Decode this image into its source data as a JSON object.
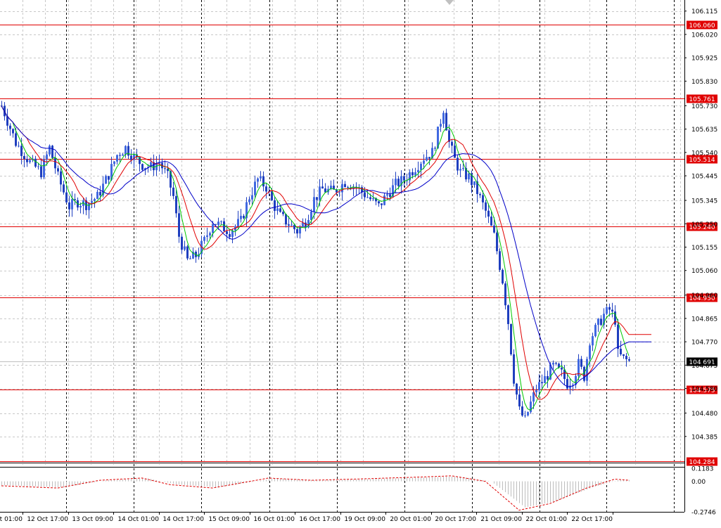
{
  "chart_data": {
    "type": "candlestick",
    "symbol_note": "",
    "ylim": [
      104.27,
      106.16
    ],
    "y_ticks": [
      "106.115",
      "106.020",
      "105.925",
      "105.830",
      "105.730",
      "105.635",
      "105.540",
      "105.445",
      "105.345",
      "105.250",
      "105.155",
      "105.060",
      "104.960",
      "104.865",
      "104.770",
      "104.675",
      "104.580",
      "104.480",
      "104.385"
    ],
    "x_ticks": [
      "12 Oct 01:00",
      "12 Oct 17:00",
      "13 Oct 09:00",
      "14 Oct 01:00",
      "14 Oct 17:00",
      "15 Oct 09:00",
      "16 Oct 01:00",
      "16 Oct 17:00",
      "19 Oct 09:00",
      "20 Oct 01:00",
      "20 Oct 17:00",
      "21 Oct 09:00",
      "22 Oct 01:00",
      "22 Oct 17:00"
    ],
    "levels": [
      {
        "label": "106.060",
        "value": 106.06
      },
      {
        "label": "105.761",
        "value": 105.761
      },
      {
        "label": "105.514",
        "value": 105.514
      },
      {
        "label": "105.240",
        "value": 105.24
      },
      {
        "label": "104.950",
        "value": 104.95
      },
      {
        "label": "104.575",
        "value": 104.575
      },
      {
        "label": "104.284",
        "value": 104.284
      }
    ],
    "current_price": {
      "label": "104.691",
      "value": 104.691
    },
    "price_path": [
      {
        "x": 0,
        "y": 105.73
      },
      {
        "x": 5,
        "y": 105.58
      },
      {
        "x": 10,
        "y": 105.5
      },
      {
        "x": 14,
        "y": 105.46
      },
      {
        "x": 17,
        "y": 105.56
      },
      {
        "x": 20,
        "y": 105.44
      },
      {
        "x": 24,
        "y": 105.32
      },
      {
        "x": 27,
        "y": 105.34
      },
      {
        "x": 30,
        "y": 105.33
      },
      {
        "x": 34,
        "y": 105.36
      },
      {
        "x": 38,
        "y": 105.45
      },
      {
        "x": 41,
        "y": 105.53
      },
      {
        "x": 44,
        "y": 105.56
      },
      {
        "x": 47,
        "y": 105.52
      },
      {
        "x": 50,
        "y": 105.49
      },
      {
        "x": 53,
        "y": 105.48
      },
      {
        "x": 56,
        "y": 105.5
      },
      {
        "x": 59,
        "y": 105.44
      },
      {
        "x": 61,
        "y": 105.36
      },
      {
        "x": 63,
        "y": 105.2
      },
      {
        "x": 66,
        "y": 105.1
      },
      {
        "x": 69,
        "y": 105.12
      },
      {
        "x": 72,
        "y": 105.18
      },
      {
        "x": 75,
        "y": 105.26
      },
      {
        "x": 78,
        "y": 105.24
      },
      {
        "x": 81,
        "y": 105.22
      },
      {
        "x": 85,
        "y": 105.26
      },
      {
        "x": 88,
        "y": 105.36
      },
      {
        "x": 91,
        "y": 105.43
      },
      {
        "x": 94,
        "y": 105.4
      },
      {
        "x": 96,
        "y": 105.34
      },
      {
        "x": 99,
        "y": 105.28
      },
      {
        "x": 102,
        "y": 105.25
      },
      {
        "x": 105,
        "y": 105.22
      },
      {
        "x": 108,
        "y": 105.26
      },
      {
        "x": 111,
        "y": 105.35
      },
      {
        "x": 114,
        "y": 105.39
      },
      {
        "x": 118,
        "y": 105.38
      },
      {
        "x": 122,
        "y": 105.42
      },
      {
        "x": 126,
        "y": 105.4
      },
      {
        "x": 130,
        "y": 105.36
      },
      {
        "x": 134,
        "y": 105.32
      },
      {
        "x": 137,
        "y": 105.37
      },
      {
        "x": 140,
        "y": 105.41
      },
      {
        "x": 143,
        "y": 105.43
      },
      {
        "x": 147,
        "y": 105.48
      },
      {
        "x": 150,
        "y": 105.52
      },
      {
        "x": 153,
        "y": 105.54
      },
      {
        "x": 155,
        "y": 105.62
      },
      {
        "x": 157,
        "y": 105.72
      },
      {
        "x": 159,
        "y": 105.58
      },
      {
        "x": 161,
        "y": 105.51
      },
      {
        "x": 163,
        "y": 105.46
      },
      {
        "x": 166,
        "y": 105.44
      },
      {
        "x": 169,
        "y": 105.38
      },
      {
        "x": 172,
        "y": 105.3
      },
      {
        "x": 175,
        "y": 105.2
      },
      {
        "x": 178,
        "y": 105.02
      },
      {
        "x": 180,
        "y": 104.85
      },
      {
        "x": 182,
        "y": 104.62
      },
      {
        "x": 184,
        "y": 104.49
      },
      {
        "x": 186,
        "y": 104.45
      },
      {
        "x": 188,
        "y": 104.52
      },
      {
        "x": 190,
        "y": 104.58
      },
      {
        "x": 193,
        "y": 104.62
      },
      {
        "x": 196,
        "y": 104.67
      },
      {
        "x": 199,
        "y": 104.64
      },
      {
        "x": 201,
        "y": 104.6
      },
      {
        "x": 203,
        "y": 104.62
      },
      {
        "x": 205,
        "y": 104.68
      },
      {
        "x": 207,
        "y": 104.63
      },
      {
        "x": 209,
        "y": 104.78
      },
      {
        "x": 212,
        "y": 104.84
      },
      {
        "x": 214,
        "y": 104.88
      },
      {
        "x": 216,
        "y": 104.9
      },
      {
        "x": 218,
        "y": 104.86
      },
      {
        "x": 219,
        "y": 104.72
      },
      {
        "x": 221,
        "y": 104.7
      },
      {
        "x": 223,
        "y": 104.69
      }
    ],
    "indicators": [
      {
        "type": "moving-average",
        "color": "#00c800"
      },
      {
        "type": "moving-average",
        "color": "#e00000"
      },
      {
        "type": "moving-average",
        "color": "#0000c8"
      }
    ],
    "oscillator": {
      "y_ticks": [
        "0.1183",
        "0.00",
        "-0.2746"
      ],
      "ylim": [
        -0.2746,
        0.1183
      ],
      "signal": [
        {
          "x": 0,
          "y": -0.04
        },
        {
          "x": 20,
          "y": -0.06
        },
        {
          "x": 35,
          "y": 0.01
        },
        {
          "x": 50,
          "y": 0.03
        },
        {
          "x": 60,
          "y": -0.03
        },
        {
          "x": 75,
          "y": -0.06
        },
        {
          "x": 95,
          "y": 0.03
        },
        {
          "x": 110,
          "y": 0.01
        },
        {
          "x": 125,
          "y": 0.02
        },
        {
          "x": 150,
          "y": 0.04
        },
        {
          "x": 160,
          "y": 0.05
        },
        {
          "x": 172,
          "y": 0.0
        },
        {
          "x": 184,
          "y": -0.26
        },
        {
          "x": 195,
          "y": -0.2
        },
        {
          "x": 208,
          "y": -0.06
        },
        {
          "x": 218,
          "y": 0.02
        },
        {
          "x": 223,
          "y": 0.01
        }
      ]
    }
  }
}
